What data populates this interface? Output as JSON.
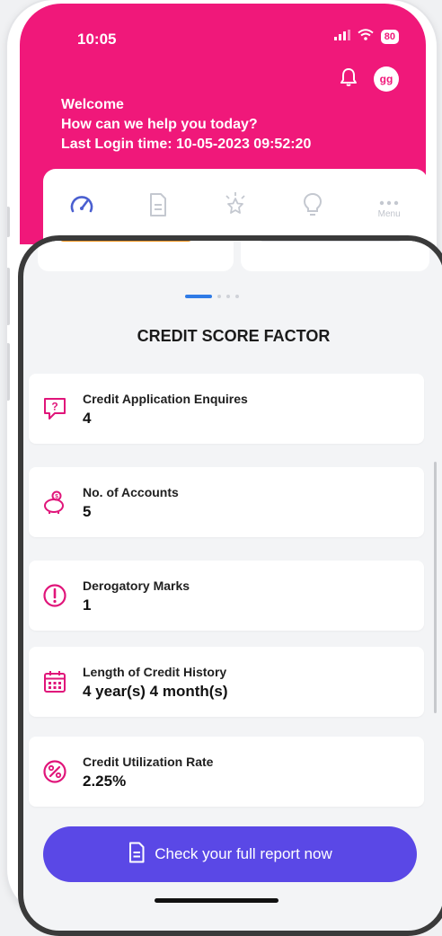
{
  "status_bar": {
    "time": "10:05",
    "battery": "80"
  },
  "header": {
    "avatar_initials": "gg",
    "welcome": "Welcome",
    "help_prompt": "How can we help you today?",
    "last_login": "Last Login time: 10-05-2023 09:52:20"
  },
  "tabs": {
    "items": [
      {
        "icon": "speedometer-icon",
        "active": true
      },
      {
        "icon": "document-icon",
        "active": false
      },
      {
        "icon": "star-badge-icon",
        "active": false
      },
      {
        "icon": "lightbulb-icon",
        "active": false
      },
      {
        "icon": "more-dots-icon",
        "label": "Menu",
        "active": false
      }
    ]
  },
  "carousel": {
    "page_count": 4,
    "active_index": 0
  },
  "section": {
    "title": "CREDIT SCORE FACTOR"
  },
  "factors": [
    {
      "label": "Credit Application Enquires",
      "value": "4",
      "icon": "question-chat-icon"
    },
    {
      "label": "No. of Accounts",
      "value": "5",
      "icon": "piggy-bank-icon"
    },
    {
      "label": "Derogatory Marks",
      "value": "1",
      "icon": "exclamation-circle-icon"
    },
    {
      "label": "Length of Credit History",
      "value": "4 year(s) 4 month(s)",
      "icon": "calendar-icon"
    },
    {
      "label": "Credit Utilization Rate",
      "value": "2.25%",
      "icon": "percent-icon"
    }
  ],
  "cta": {
    "label": "Check your full report now"
  },
  "colors": {
    "brand_pink": "#f0187a",
    "cta_purple": "#5a48e6",
    "accent_orange": "#f7941d",
    "carousel_active": "#2f7be6"
  }
}
